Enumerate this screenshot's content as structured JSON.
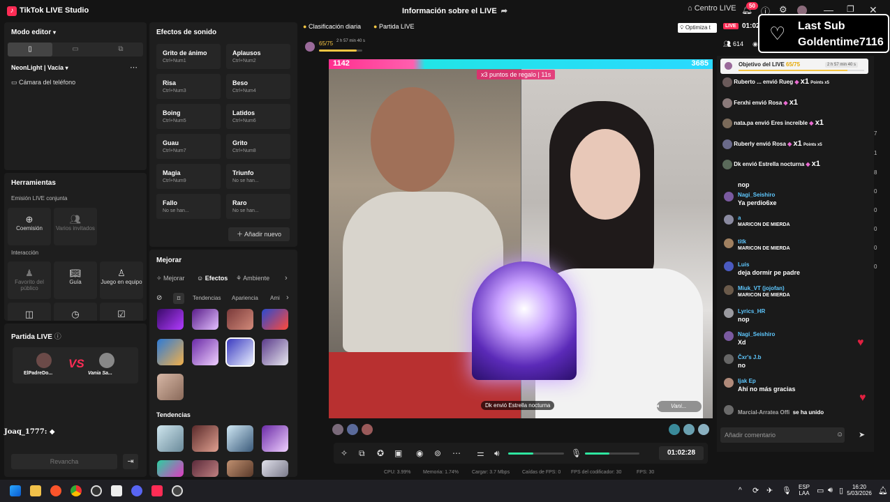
{
  "app": {
    "title": "TikTok LIVE Studio",
    "center_title": "Información sobre el LIVE",
    "centro_live": "Centro LIVE",
    "notif_count": "50"
  },
  "left": {
    "modo_editor": "Modo editor",
    "scene": "NeonLight | Vacía",
    "source": "Cámara del teléfono",
    "herramientas": "Herramientas",
    "emision": "Emisión LIVE conjunta",
    "coemision": "Coemisión",
    "varios": "Varios invitados",
    "interaccion": "Interacción",
    "favorito": "Favorito del público",
    "guia": "Guía",
    "juego": "Juego en equipo",
    "partida": "Partida LIVE",
    "player1": "ElPadreDo...",
    "player2": "Vania Sa...",
    "vs": "VS",
    "user_tag": "Joaq_1777:",
    "revancha": "Revancha"
  },
  "sfx": {
    "title": "Efectos de sonido",
    "items": [
      {
        "name": "Grito de ánimo",
        "key": "Ctrl+Num1"
      },
      {
        "name": "Aplausos",
        "key": "Ctrl+Num2"
      },
      {
        "name": "Risa",
        "key": "Ctrl+Num3"
      },
      {
        "name": "Beso",
        "key": "Ctrl+Num4"
      },
      {
        "name": "Boing",
        "key": "Ctrl+Num5"
      },
      {
        "name": "Latidos",
        "key": "Ctrl+Num6"
      },
      {
        "name": "Guau",
        "key": "Ctrl+Num7"
      },
      {
        "name": "Grito",
        "key": "Ctrl+Num8"
      },
      {
        "name": "Magia",
        "key": "Ctrl+Num9"
      },
      {
        "name": "Triunfo",
        "key": "No se han..."
      },
      {
        "name": "Fallo",
        "key": "No se han..."
      },
      {
        "name": "Raro",
        "key": "No se han..."
      }
    ],
    "add": "Añadir nuevo"
  },
  "mejorar": {
    "title": "Mejorar",
    "tabs": [
      "Mejorar",
      "Efectos",
      "Ambiente"
    ],
    "subtabs": [
      "Tendencias",
      "Apariencia",
      "Ami"
    ],
    "tendencias": "Tendencias"
  },
  "top": {
    "clasificacion": "Clasificación diaria",
    "partida": "Partida LIVE",
    "optimiza": "Optimiza t",
    "goal_count": "65/75",
    "goal_time": "2 h 57 min 40 s",
    "live_time": "01:02"
  },
  "video": {
    "score_left": "1142",
    "score_right": "3685",
    "gift_multiplier": "x3 puntos de regalo | 11s",
    "gift_note": "Dk envió Estrella nocturna",
    "right_user": "Vani..."
  },
  "controls": {
    "timer": "01:02:28",
    "mic_level": 0.45,
    "vol_level": 0.45
  },
  "stats": {
    "cpu": "CPU: 3.99%",
    "mem": "Memoria: 1.74%",
    "upload": "Cargar: 3.7 Mbps",
    "fps_drop": "Caídas de FPS: 0",
    "fps_enc": "FPS del codificador: 30",
    "fps": "FPS: 30"
  },
  "chat": {
    "viewers": "614",
    "goal_label": "Objetivo del LIVE",
    "goal_count": "65/75",
    "goal_time": "2 h 57 min 40 s",
    "gifts": [
      {
        "text": "Ruberto ... envió Rueg",
        "mult": "x1",
        "extra": "Points x5"
      },
      {
        "text": "Ferxhi envió Rosa",
        "mult": "x1",
        "extra": ""
      },
      {
        "text": "nata.pa envió Eres increíble",
        "mult": "x1",
        "extra": ""
      },
      {
        "text": "Ruberly envió Rosa",
        "mult": "x1",
        "extra": "Points x5"
      },
      {
        "text": "Dk envió Estrella nocturna",
        "mult": "x1",
        "extra": ""
      }
    ],
    "messages": [
      {
        "name": "",
        "text": "nop"
      },
      {
        "name": "Nagi_Seishiro",
        "text": "Ya perdio6xe"
      },
      {
        "name": "a",
        "text": "MARICON DE MIERDA"
      },
      {
        "name": "titk",
        "text": "MARICON DE MIERDA"
      },
      {
        "name": "Luis",
        "text": "deja dormir pe padre"
      },
      {
        "name": "Miuk_VT (jojofan)",
        "text": "MARICON DE MIERDA"
      },
      {
        "name": "Lyrics_HR",
        "text": "nop"
      },
      {
        "name": "Nagi_Seishiro",
        "text": "Xd"
      },
      {
        "name": "Čxr's J.b",
        "text": "no"
      },
      {
        "name": "Ijak Ep",
        "text": "Ahí no más gracias"
      }
    ],
    "joined_name": "Marcial-Arratea Offi",
    "joined_text": "se ha unido",
    "placeholder": "Añadir comentario"
  },
  "lastsub": {
    "line1": "Last Sub",
    "line2": "Goldentime7116"
  },
  "taskbar": {
    "lang1": "ESP",
    "lang2": "LAA",
    "time": "16:20",
    "date": "5/03/2026"
  },
  "right_nums": [
    "7",
    "1",
    "8",
    "0",
    "0",
    "0",
    "0",
    "0"
  ]
}
